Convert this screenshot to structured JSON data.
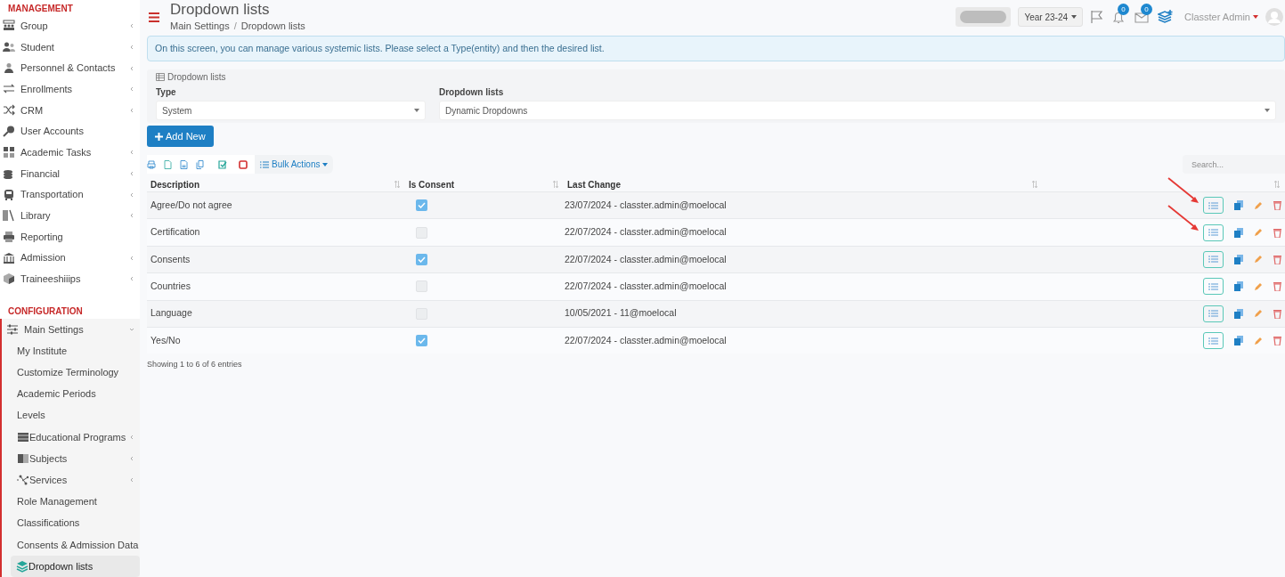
{
  "sidebar": {
    "sections": [
      {
        "title": "MANAGEMENT",
        "items": [
          {
            "label": "Group",
            "kind": "group",
            "expandable": true
          },
          {
            "label": "Student",
            "kind": "people",
            "expandable": true
          },
          {
            "label": "Personnel & Contacts",
            "kind": "person",
            "expandable": true
          },
          {
            "label": "Enrollments",
            "kind": "swap",
            "expandable": true
          },
          {
            "label": "CRM",
            "kind": "shuffle",
            "expandable": true
          },
          {
            "label": "User Accounts",
            "kind": "key",
            "expandable": false
          },
          {
            "label": "Academic Tasks",
            "kind": "grid",
            "expandable": true
          },
          {
            "label": "Financial",
            "kind": "coins",
            "expandable": true
          },
          {
            "label": "Transportation",
            "kind": "bus",
            "expandable": true
          },
          {
            "label": "Library",
            "kind": "books",
            "expandable": true
          },
          {
            "label": "Reporting",
            "kind": "printer",
            "expandable": false
          },
          {
            "label": "Admission",
            "kind": "bank",
            "expandable": true
          },
          {
            "label": "Traineeshiiips",
            "kind": "cube",
            "expandable": true
          }
        ]
      },
      {
        "title": "CONFIGURATION",
        "items": [
          {
            "label": "Main Settings",
            "kind": "sliders",
            "expandable": true,
            "expanded": true,
            "children": [
              {
                "label": "My Institute",
                "selected": false
              },
              {
                "label": "Customize Terminology",
                "selected": false
              },
              {
                "label": "Academic Periods",
                "selected": false
              },
              {
                "label": "Levels",
                "selected": false
              },
              {
                "label": "Educational Programs",
                "kind": "tape",
                "expandable": true,
                "selected": false
              },
              {
                "label": "Subjects",
                "kind": "book",
                "expandable": true,
                "selected": false
              },
              {
                "label": "Services",
                "kind": "nodes",
                "expandable": true,
                "selected": false
              },
              {
                "label": "Role Management",
                "selected": false
              },
              {
                "label": "Classifications",
                "selected": false
              },
              {
                "label": "Consents & Admission Data",
                "selected": false
              },
              {
                "label": "Dropdown lists",
                "kind": "layers",
                "selected": true
              }
            ]
          }
        ]
      }
    ]
  },
  "header": {
    "title": "Dropdown lists",
    "breadcrumb": [
      "Main Settings",
      "Dropdown lists"
    ],
    "breadcrumb_separator": "/",
    "year": "Year 23-24",
    "notifications": "0",
    "messages": "0",
    "user": "Classter Admin"
  },
  "info": "On this screen, you can manage various systemic lists. Please select a Type(entity) and then the desired list.",
  "filter": {
    "legend": "Dropdown lists",
    "type_label": "Type",
    "type_value": "System",
    "list_label": "Dropdown lists",
    "list_value": "Dynamic Dropdowns"
  },
  "add_button": "Add New",
  "bulk_actions": "Bulk Actions",
  "search": {
    "placeholder": "Search..."
  },
  "table": {
    "columns": [
      "Description",
      "Is Consent",
      "Last Change"
    ],
    "rows": [
      {
        "description": "Agree/Do not agree",
        "consent": true,
        "last_change": "23/07/2024 - classter.admin@moelocal",
        "marked": true
      },
      {
        "description": "Certification",
        "consent": false,
        "last_change": "22/07/2024 - classter.admin@moelocal",
        "marked": true
      },
      {
        "description": "Consents",
        "consent": true,
        "last_change": "22/07/2024 - classter.admin@moelocal",
        "marked": false
      },
      {
        "description": "Countries",
        "consent": false,
        "last_change": "22/07/2024 - classter.admin@moelocal",
        "marked": false
      },
      {
        "description": "Language",
        "consent": false,
        "last_change": "10/05/2021 - 11@moelocal",
        "marked": false
      },
      {
        "description": "Yes/No",
        "consent": true,
        "last_change": "22/07/2024 - classter.admin@moelocal",
        "marked": false
      }
    ],
    "footer": "Showing 1 to 6 of 6 entries"
  }
}
